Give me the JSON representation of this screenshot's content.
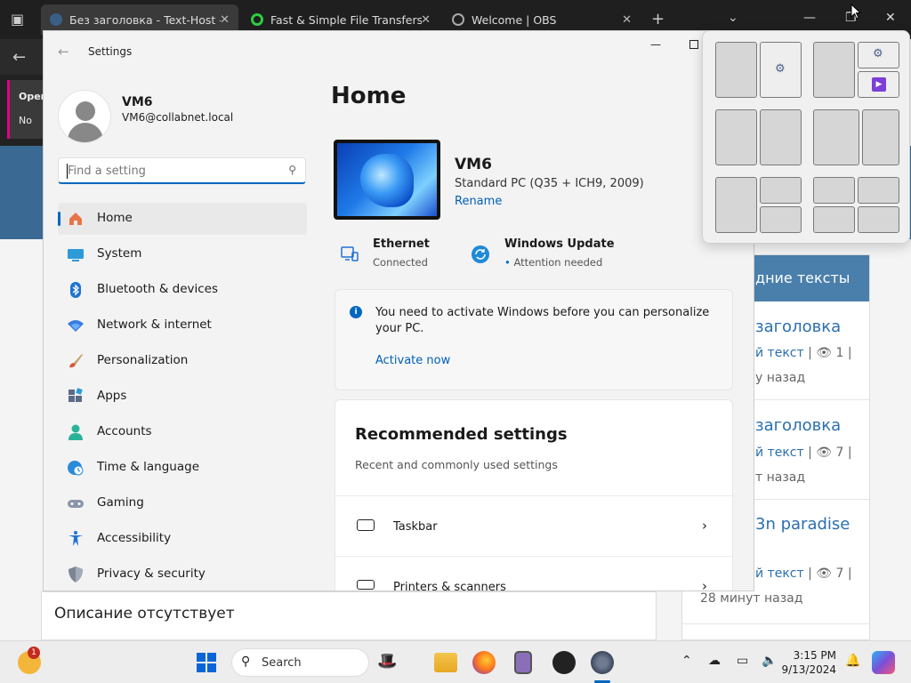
{
  "browser": {
    "tabs": [
      {
        "label": "Без заголовка - Text-Host - тек",
        "active": true
      },
      {
        "label": "Fast & Simple File Transfers - Fi",
        "active": false
      },
      {
        "label": "Welcome | OBS",
        "active": false
      }
    ],
    "new_tab_symbol": "+",
    "sidebar_open_label": "Oper",
    "sidebar_sub_label": "No"
  },
  "background_page": {
    "description_text": "Описание отсутствует",
    "card_header": "дние тексты",
    "items": [
      {
        "title": "заголовка",
        "meta_link": "й текст",
        "meta_rest": " | 👁 1 |",
        "age": "у назад"
      },
      {
        "title": "заголовка",
        "meta_link": "й текст",
        "meta_rest": " | 👁 7 |",
        "age": "т назад"
      },
      {
        "title": "3n paradise",
        "meta_link": "й текст",
        "meta_rest": " | 👁 7 |",
        "age": "28 минут назад"
      }
    ]
  },
  "settings": {
    "window_title": "Settings",
    "user": {
      "name": "VM6",
      "email": "VM6@collabnet.local"
    },
    "search_placeholder": "Find a setting",
    "nav": [
      {
        "label": "Home",
        "icon": "home-icon",
        "selected": true
      },
      {
        "label": "System",
        "icon": "system-icon",
        "selected": false
      },
      {
        "label": "Bluetooth & devices",
        "icon": "bluetooth-icon",
        "selected": false
      },
      {
        "label": "Network & internet",
        "icon": "wifi-icon",
        "selected": false
      },
      {
        "label": "Personalization",
        "icon": "brush-icon",
        "selected": false
      },
      {
        "label": "Apps",
        "icon": "apps-icon",
        "selected": false
      },
      {
        "label": "Accounts",
        "icon": "accounts-icon",
        "selected": false
      },
      {
        "label": "Time & language",
        "icon": "globe-clock-icon",
        "selected": false
      },
      {
        "label": "Gaming",
        "icon": "gamepad-icon",
        "selected": false
      },
      {
        "label": "Accessibility",
        "icon": "accessibility-icon",
        "selected": false
      },
      {
        "label": "Privacy & security",
        "icon": "shield-icon",
        "selected": false
      }
    ],
    "main": {
      "title": "Home",
      "pc_name": "VM6",
      "pc_spec": "Standard PC (Q35 + ICH9, 2009)",
      "rename_label": "Rename",
      "ethernet_title": "Ethernet",
      "ethernet_status": "Connected",
      "update_title": "Windows Update",
      "update_status": "Attention needed",
      "activation_message": "You need to activate Windows before you can personalize your PC.",
      "activation_link": "Activate now",
      "recommended_title": "Recommended settings",
      "recommended_subtitle": "Recent and commonly used settings",
      "recommended_items": [
        {
          "label": "Taskbar"
        },
        {
          "label": "Printers & scanners"
        }
      ]
    }
  },
  "taskbar": {
    "weather_badge": "1",
    "search_label": "Search",
    "time": "3:15 PM",
    "date": "9/13/2024"
  },
  "colors": {
    "accent": "#0067c0",
    "browser_chrome": "#1f1f1f",
    "bg_band": "#3a6a93"
  }
}
